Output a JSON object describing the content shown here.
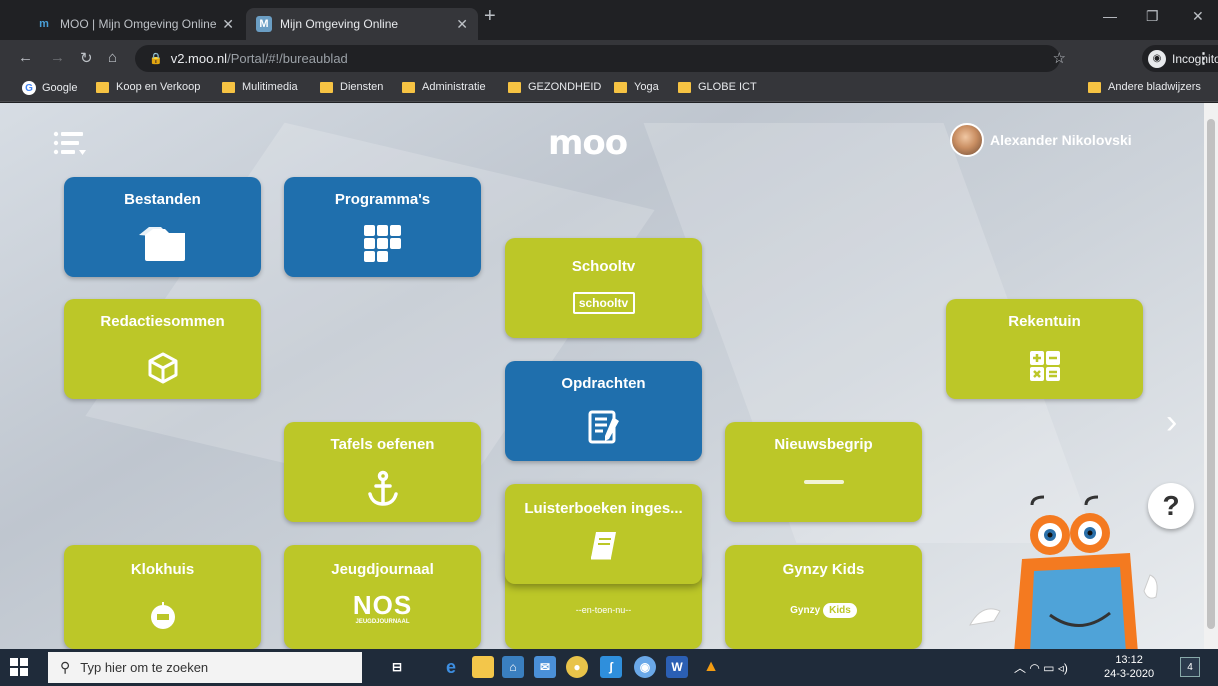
{
  "browser": {
    "tabs": [
      {
        "title": "MOO | Mijn Omgeving Online",
        "favicon": "m"
      },
      {
        "title": "Mijn Omgeving Online",
        "favicon": "M"
      }
    ],
    "new_tab": "+",
    "window_controls": {
      "minimize": "—",
      "restore": "❐",
      "close": "✕"
    },
    "url_host": "v2.moo.nl",
    "url_path": "/Portal/#!/bureaublad",
    "incognito_label": "Incognito",
    "bookmarks": [
      "Google",
      "Koop en Verkoop",
      "Mulitimedia",
      "Diensten",
      "Administratie",
      "GEZONDHEID",
      "Yoga",
      "GLOBE ICT"
    ],
    "other_bookmarks": "Andere bladwijzers"
  },
  "page": {
    "logo": "moo",
    "user_name": "Alexander Nikolovski",
    "tiles": [
      {
        "label": "Bestanden",
        "icon": "folders-icon"
      },
      {
        "label": "Programma's",
        "icon": "grid-icon"
      },
      {
        "label": "Schooltv",
        "icon": "schooltv-logo",
        "logo_text": "schooltv"
      },
      {
        "label": "Redactiesommen",
        "icon": "cube-icon"
      },
      {
        "label": "Rekentuin",
        "icon": "calculator-icon"
      },
      {
        "label": "Opdrachten",
        "icon": "assignment-icon"
      },
      {
        "label": "Tafels oefenen",
        "icon": "anchor-icon"
      },
      {
        "label": "Nieuwsbegrip",
        "icon": "nieuwsbegrip-logo"
      },
      {
        "label": "Luisterboeken inges...",
        "icon": "book-icon"
      },
      {
        "label": "Klokhuis",
        "icon": "klokhuis-logo"
      },
      {
        "label": "Jeugdjournaal",
        "icon": "nos-logo",
        "logo_text": "NOS",
        "logo_sub": "JEUGDJOURNAAL"
      },
      {
        "label": "",
        "icon": "entoen-logo",
        "logo_text": "--en-toen-nu--"
      },
      {
        "label": "Gynzy Kids",
        "icon": "gynzy-logo",
        "logo_text": "Gynzy",
        "logo_badge": "Kids"
      }
    ],
    "help": "?"
  },
  "taskbar": {
    "search_placeholder": "Typ hier om te zoeken",
    "time": "13:12",
    "date": "24-3-2020",
    "notifications": "4"
  }
}
